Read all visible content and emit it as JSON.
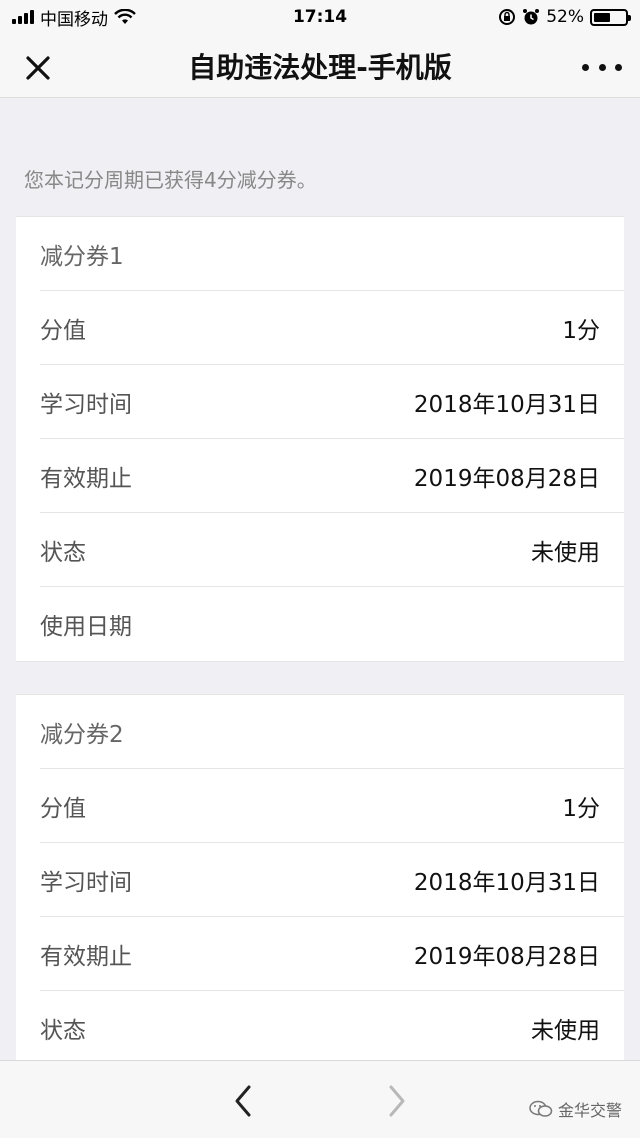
{
  "status_bar": {
    "carrier": "中国移动",
    "time": "17:14",
    "battery_percent": "52%",
    "battery_level": 0.52,
    "icons": [
      "signal-icon",
      "wifi-icon",
      "rotation-lock-icon",
      "alarm-icon",
      "battery-icon"
    ]
  },
  "nav": {
    "title": "自助违法处理-手机版",
    "close_icon": "close-icon",
    "more_icon": "more-icon"
  },
  "notice": "您本记分周期已获得4分减分券。",
  "coupons": [
    {
      "name": "减分券1",
      "rows": [
        {
          "label": "分值",
          "value": "1分"
        },
        {
          "label": "学习时间",
          "value": "2018年10月31日"
        },
        {
          "label": "有效期止",
          "value": "2019年08月28日"
        },
        {
          "label": "状态",
          "value": "未使用"
        },
        {
          "label": "使用日期",
          "value": ""
        }
      ]
    },
    {
      "name": "减分券2",
      "rows": [
        {
          "label": "分值",
          "value": "1分"
        },
        {
          "label": "学习时间",
          "value": "2018年10月31日"
        },
        {
          "label": "有效期止",
          "value": "2019年08月28日"
        },
        {
          "label": "状态",
          "value": "未使用"
        }
      ]
    }
  ],
  "toolbar": {
    "back_icon": "chevron-left-icon",
    "forward_icon": "chevron-right-icon",
    "watermark": "金华交警"
  },
  "colors": {
    "background": "#efeff4",
    "bar": "#f7f7f7",
    "label": "#555555",
    "value": "#111111",
    "notice": "#888888"
  }
}
